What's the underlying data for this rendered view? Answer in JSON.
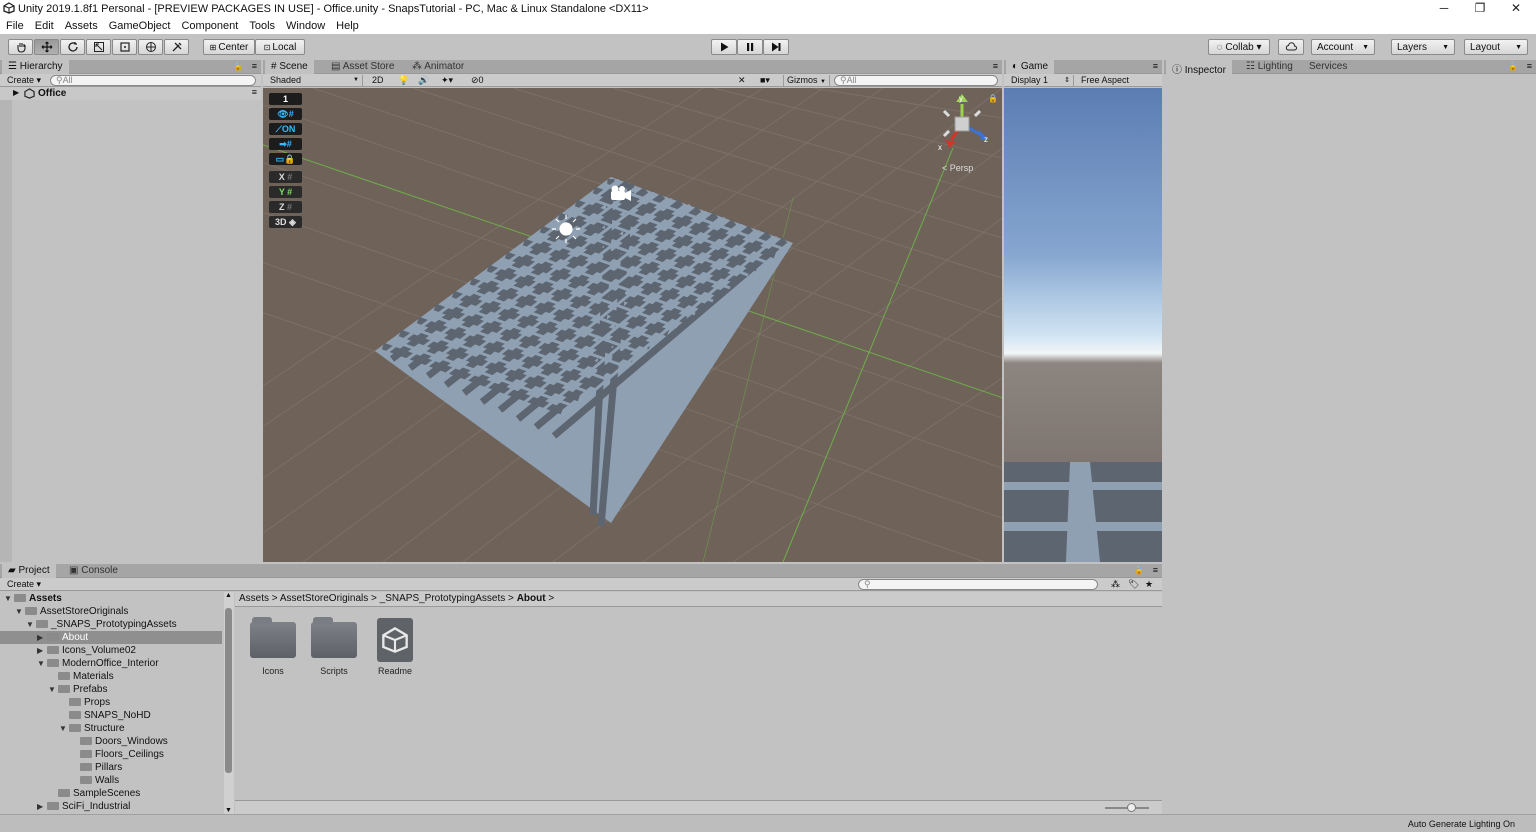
{
  "window": {
    "title": "Unity 2019.1.8f1 Personal - [PREVIEW PACKAGES IN USE] - Office.unity - SnapsTutorial - PC, Mac & Linux Standalone <DX11>",
    "minimize": "─",
    "maximize": "❐",
    "close": "✕"
  },
  "menu": [
    "File",
    "Edit",
    "Assets",
    "GameObject",
    "Component",
    "Tools",
    "Window",
    "Help"
  ],
  "toolbar": {
    "center": "Center",
    "local": "Local",
    "collab": "Collab ▾",
    "account": "Account",
    "layers": "Layers",
    "layout": "Layout"
  },
  "hierarchy": {
    "tab": "Hierarchy",
    "create": "Create ▾",
    "search_placeholder": "All",
    "scene": "Office"
  },
  "scene": {
    "tabs": [
      "Scene",
      "Asset Store",
      "Animator"
    ],
    "shading": "Shaded",
    "mode_2d": "2D",
    "fx_count": "0",
    "gizmos": "Gizmos",
    "search_placeholder": "All",
    "persp": "< Persp",
    "overlay": [
      "1",
      "ON",
      "X",
      "Y",
      "Z",
      "3D"
    ]
  },
  "game": {
    "tab": "Game",
    "display": "Display 1",
    "aspect": "Free Aspect"
  },
  "inspector": {
    "tabs": [
      "Inspector",
      "Lighting",
      "Services"
    ]
  },
  "project": {
    "tabs": [
      "Project",
      "Console"
    ],
    "create": "Create ▾",
    "breadcrumb": [
      "Assets",
      "AssetStoreOriginals",
      "_SNAPS_PrototypingAssets",
      "About"
    ],
    "tree": [
      {
        "label": "Assets",
        "depth": 0,
        "arrow": "▼",
        "bold": true
      },
      {
        "label": "AssetStoreOriginals",
        "depth": 1,
        "arrow": "▼"
      },
      {
        "label": "_SNAPS_PrototypingAssets",
        "depth": 2,
        "arrow": "▼"
      },
      {
        "label": "About",
        "depth": 3,
        "arrow": "▶",
        "selected": true
      },
      {
        "label": "Icons_Volume02",
        "depth": 3,
        "arrow": "▶"
      },
      {
        "label": "ModernOffice_Interior",
        "depth": 3,
        "arrow": "▼"
      },
      {
        "label": "Materials",
        "depth": 4,
        "arrow": ""
      },
      {
        "label": "Prefabs",
        "depth": 4,
        "arrow": "▼"
      },
      {
        "label": "Props",
        "depth": 5,
        "arrow": ""
      },
      {
        "label": "SNAPS_NoHD",
        "depth": 5,
        "arrow": ""
      },
      {
        "label": "Structure",
        "depth": 5,
        "arrow": "▼"
      },
      {
        "label": "Doors_Windows",
        "depth": 6,
        "arrow": ""
      },
      {
        "label": "Floors_Ceilings",
        "depth": 6,
        "arrow": ""
      },
      {
        "label": "Pillars",
        "depth": 6,
        "arrow": ""
      },
      {
        "label": "Walls",
        "depth": 6,
        "arrow": ""
      },
      {
        "label": "SampleScenes",
        "depth": 4,
        "arrow": ""
      },
      {
        "label": "SciFi_Industrial",
        "depth": 3,
        "arrow": "▶"
      }
    ],
    "assets": [
      {
        "label": "Icons",
        "kind": "folder"
      },
      {
        "label": "Scripts",
        "kind": "folder"
      },
      {
        "label": "Readme",
        "kind": "unity"
      }
    ]
  },
  "status": "Auto Generate Lighting On"
}
